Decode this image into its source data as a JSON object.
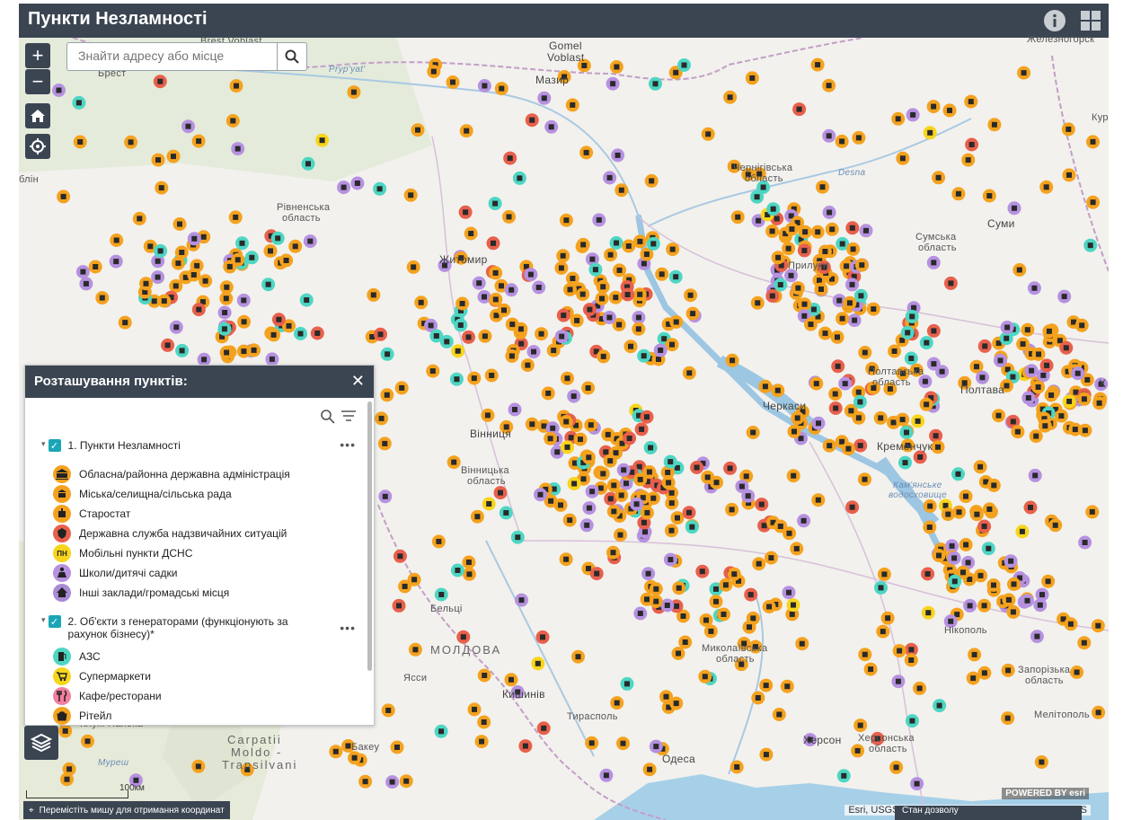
{
  "app": {
    "title": "Пункти Незламності"
  },
  "search": {
    "placeholder": "Знайти адресу або місце"
  },
  "map": {
    "labels": [
      {
        "text": "Brest Voblast",
        "cls": ""
      },
      {
        "text": "Gomel",
        "cls": "mid"
      },
      {
        "text": "Voblast",
        "cls": "mid"
      },
      {
        "text": "Железногорск",
        "cls": ""
      },
      {
        "text": "Pryp'yat'",
        "cls": "river"
      },
      {
        "text": "Брест",
        "cls": ""
      },
      {
        "text": "Мазир",
        "cls": "mid"
      },
      {
        "text": "Курс",
        "cls": ""
      },
      {
        "text": "блін",
        "cls": ""
      },
      {
        "text": "Чернігівська",
        "cls": ""
      },
      {
        "text": "область",
        "cls": ""
      },
      {
        "text": "Desna",
        "cls": "river"
      },
      {
        "text": "Рівненська",
        "cls": ""
      },
      {
        "text": "область",
        "cls": ""
      },
      {
        "text": "Суми",
        "cls": "mid"
      },
      {
        "text": "Сумська",
        "cls": ""
      },
      {
        "text": "область",
        "cls": ""
      },
      {
        "text": "Житомир",
        "cls": "mid"
      },
      {
        "text": "Прилуки",
        "cls": ""
      },
      {
        "text": "Полтавська",
        "cls": ""
      },
      {
        "text": "область",
        "cls": ""
      },
      {
        "text": "Полтава",
        "cls": "mid"
      },
      {
        "text": "Черкаси",
        "cls": "mid"
      },
      {
        "text": "Кременчук",
        "cls": "mid"
      },
      {
        "text": "Вінницька",
        "cls": ""
      },
      {
        "text": "область",
        "cls": ""
      },
      {
        "text": "Вінниця",
        "cls": "mid"
      },
      {
        "text": "Кам'янське",
        "cls": "river"
      },
      {
        "text": "водосховище",
        "cls": "river"
      },
      {
        "text": "Бельці",
        "cls": ""
      },
      {
        "text": "МОЛДОВА",
        "cls": "big"
      },
      {
        "text": "Ясси",
        "cls": ""
      },
      {
        "text": "Кишинів",
        "cls": "mid"
      },
      {
        "text": "Нікополь",
        "cls": ""
      },
      {
        "text": "Запорізька",
        "cls": ""
      },
      {
        "text": "область",
        "cls": ""
      },
      {
        "text": "Миколаївська",
        "cls": ""
      },
      {
        "text": "область",
        "cls": ""
      },
      {
        "text": "Мелітополь",
        "cls": ""
      },
      {
        "text": "Тирасполь",
        "cls": ""
      },
      {
        "text": "Херсон",
        "cls": "mid"
      },
      {
        "text": "Херсонська",
        "cls": ""
      },
      {
        "text": "область",
        "cls": ""
      },
      {
        "text": "Клуж-Напока",
        "cls": ""
      },
      {
        "text": "Carpatii",
        "cls": "big"
      },
      {
        "text": "Moldo -",
        "cls": "big"
      },
      {
        "text": "Transilvani",
        "cls": "big"
      },
      {
        "text": "Бакеу",
        "cls": ""
      },
      {
        "text": "Муреш",
        "cls": "river"
      },
      {
        "text": "Одеса",
        "cls": "mid"
      },
      {
        "text": "Х",
        "cls": "mid"
      }
    ]
  },
  "legend": {
    "title": "Розташування пунктів:",
    "group1": "1. Пункти Незламності",
    "items1": [
      {
        "label": "Обласна/районна державна адміністрація",
        "icon": "building-icon",
        "color": "#f4a21e"
      },
      {
        "label": "Міська/селищна/сільська рада",
        "icon": "townhall-icon",
        "color": "#f4a21e"
      },
      {
        "label": "Старостат",
        "icon": "starostat-icon",
        "color": "#f4a21e"
      },
      {
        "label": "Державна служба надзвичайних ситуацій",
        "icon": "dsns-icon",
        "color": "#e8604c"
      },
      {
        "label": "Мобільні пункти ДСНС",
        "icon": "mobile-pn-icon",
        "color": "#f7d51c"
      },
      {
        "label": "Школи/дитячі садки",
        "icon": "school-icon",
        "color": "#b691e0"
      },
      {
        "label": "Інші заклади/громадські місця",
        "icon": "house-icon",
        "color": "#a98ad4"
      }
    ],
    "group2_line1": "2. Об'єкти з генераторами (функціонують за",
    "group2_line2": "рахунок бізнесу)*",
    "items2": [
      {
        "label": "АЗС",
        "icon": "fuel-icon",
        "color": "#4dd6c3"
      },
      {
        "label": "Супермаркети",
        "icon": "cart-icon",
        "color": "#f7d51c"
      },
      {
        "label": "Кафе/ресторани",
        "icon": "restaurant-icon",
        "color": "#f27fa0"
      },
      {
        "label": "Рітейл",
        "icon": "retail-icon",
        "color": "#f4a21e"
      }
    ]
  },
  "footer": {
    "coords_hint": "Перемістіть мишу для отримання координат",
    "scale": "100км",
    "attribution": "Esri, USGS | Esri, HERE, Garmin, FAO, NOAA, USGS",
    "esri": "POWERED BY esri",
    "popup": "Стан дозволу"
  },
  "colors": {
    "header": "#3b4552",
    "orange": "#f4a21e",
    "red": "#e8604c",
    "purple": "#b691e0",
    "teal": "#4dd6c3",
    "yellow": "#f7d51c"
  }
}
